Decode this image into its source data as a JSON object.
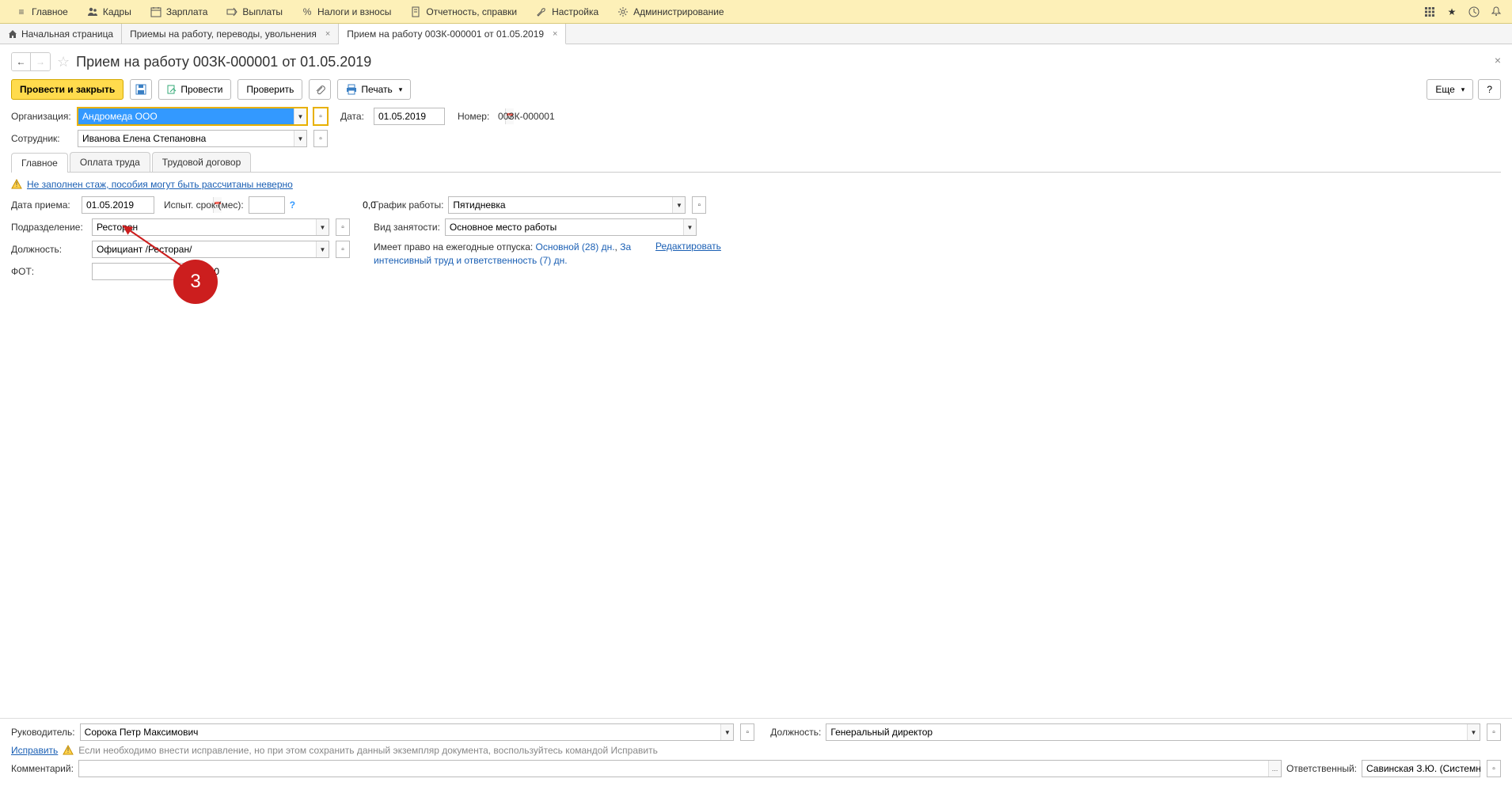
{
  "menu": {
    "items": [
      {
        "icon": "menu",
        "label": "Главное"
      },
      {
        "icon": "people",
        "label": "Кадры"
      },
      {
        "icon": "calendar",
        "label": "Зарплата"
      },
      {
        "icon": "arrow-right",
        "label": "Выплаты"
      },
      {
        "icon": "percent",
        "label": "Налоги и взносы"
      },
      {
        "icon": "document",
        "label": "Отчетность, справки"
      },
      {
        "icon": "wrench",
        "label": "Настройка"
      },
      {
        "icon": "gear",
        "label": "Администрирование"
      }
    ]
  },
  "tabs": [
    {
      "icon": "home",
      "label": "Начальная страница",
      "closable": false
    },
    {
      "label": "Приемы на работу, переводы, увольнения",
      "closable": true
    },
    {
      "label": "Прием на работу 00ЗК-000001 от 01.05.2019",
      "closable": true,
      "active": true
    }
  ],
  "page_title": "Прием на работу 00ЗК-000001 от 01.05.2019",
  "toolbar": {
    "post_close": "Провести и закрыть",
    "post": "Провести",
    "check": "Проверить",
    "print": "Печать",
    "more": "Еще",
    "help": "?"
  },
  "header_form": {
    "org_label": "Организация:",
    "org_value": "Андромеда ООО",
    "date_label": "Дата:",
    "date_value": "01.05.2019",
    "number_label": "Номер:",
    "number_value": "00ЗК-000001",
    "employee_label": "Сотрудник:",
    "employee_value": "Иванова Елена Степановна"
  },
  "sub_tabs": [
    "Главное",
    "Оплата труда",
    "Трудовой договор"
  ],
  "warning": "Не заполнен стаж, пособия могут быть рассчитаны неверно",
  "main_form": {
    "hire_date_label": "Дата приема:",
    "hire_date_value": "01.05.2019",
    "trial_label": "Испыт. срок (мес):",
    "trial_value": "0,0",
    "division_label": "Подразделение:",
    "division_value": "Ресторан",
    "position_label": "Должность:",
    "position_value": "Официант /Ресторан/",
    "fot_label": "ФОТ:",
    "fot_value": "49 250,00",
    "schedule_label": "График работы:",
    "schedule_value": "Пятидневка",
    "employment_label": "Вид занятости:",
    "employment_value": "Основное место работы",
    "vacation_label": "Имеет право на ежегодные отпуска:",
    "vacation_main": "Основной (28) дн.",
    "vacation_extra": "За интенсивный труд и ответственность (7) дн.",
    "edit": "Редактировать"
  },
  "annotation": {
    "number": "3"
  },
  "footer": {
    "manager_label": "Руководитель:",
    "manager_value": "Сорока Петр Максимович",
    "mgr_position_label": "Должность:",
    "mgr_position_value": "Генеральный директор",
    "fix_link": "Исправить",
    "fix_info": "Если необходимо внести исправление, но при этом сохранить данный экземпляр документа, воспользуйтесь командой Исправить",
    "comment_label": "Комментарий:",
    "responsible_label": "Ответственный:",
    "responsible_value": "Савинская З.Ю. (Системн"
  }
}
